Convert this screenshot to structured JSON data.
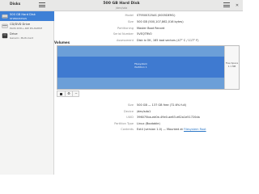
{
  "app": {
    "title": "Disks"
  },
  "window": {
    "title": "500 GB Hard Disk",
    "subtitle": "/dev/sda"
  },
  "sidebar": {
    "drives": [
      {
        "name": "500 GB Hard Disk",
        "description": "ST9500325AS",
        "icon": "hard-disk-icon",
        "selected": true
      },
      {
        "name": "CD/DVD Drive",
        "description": "PLDS DVD+-RW DS-8A8SH",
        "icon": "optical-drive-icon",
        "selected": false
      },
      {
        "name": "Drive",
        "description": "Generic- Multi-Card",
        "icon": "card-reader-icon",
        "selected": false
      }
    ]
  },
  "disk_info": {
    "model": {
      "label": "Model",
      "value": "ST9500325AS (0005DEM1)"
    },
    "size": {
      "label": "Size",
      "value": "500 GB (500,107,862,016 bytes)"
    },
    "partitioning": {
      "label": "Partitioning",
      "value": "Master Boot Record"
    },
    "serial": {
      "label": "Serial Number",
      "value": "5VEQTRV0"
    },
    "assessment": {
      "label": "Assessment",
      "value": "Disk is OK, 165 bad sectors (47° C / 117° F)"
    }
  },
  "volumes": {
    "heading": "Volumes",
    "partition": {
      "line1": "Filesystem",
      "line2": "Partition 1"
    },
    "free_space": {
      "line1": "Free Space",
      "line2": "1.1 MB"
    },
    "toolbar": {
      "stop": "stop",
      "settings": "⚙",
      "minus": "−"
    }
  },
  "volume_info": {
    "size": {
      "label": "Size",
      "value": "500 GB — 137 GB free (72.6% full)"
    },
    "device": {
      "label": "Device",
      "value": "/dev/sda1"
    },
    "uuid": {
      "label": "UUID",
      "value": "396075ba-ed0e-49e0-ae63-e62a1e51720da"
    },
    "partition_type": {
      "label": "Partition Type",
      "value": "Linux (Bootable)"
    },
    "contents": {
      "label": "Contents",
      "value_prefix": "Ext4 (version 1.0) — Mounted at ",
      "link": "Filesystem Root"
    }
  },
  "colors": {
    "accent": "#3e80d6",
    "partition": "#3f7ad0",
    "partition_light": "#6c9fd8"
  }
}
